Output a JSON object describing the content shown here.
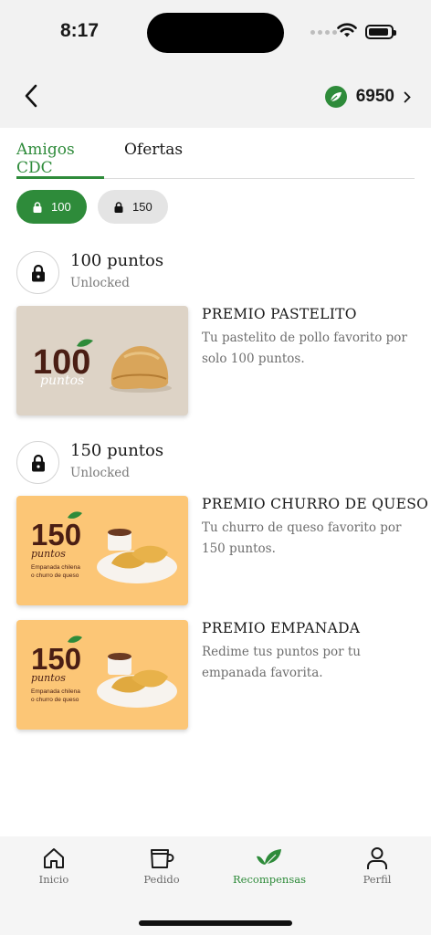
{
  "status": {
    "time": "8:17"
  },
  "header": {
    "points_value": "6950"
  },
  "tabs": [
    {
      "label": "Amigos CDC",
      "active": true
    },
    {
      "label": "Ofertas",
      "active": false
    }
  ],
  "filters": [
    {
      "label": "100",
      "active": true
    },
    {
      "label": "150",
      "active": false
    }
  ],
  "tiers": [
    {
      "title": "100 puntos",
      "status": "Unlocked",
      "rewards": [
        {
          "title": "PREMIO PASTELITO",
          "description": "Tu pastelito de pollo favorito por solo 100 puntos.",
          "image": {
            "big": "100",
            "script": "puntos"
          }
        }
      ]
    },
    {
      "title": "150 puntos",
      "status": "Unlocked",
      "rewards": [
        {
          "title": "PREMIO CHURRO DE QUESO",
          "description": "Tu churro de queso favorito por 150 puntos.",
          "image": {
            "big": "150",
            "script": "puntos",
            "caption1": "Empanada chilena",
            "caption2": "o churro de queso"
          }
        },
        {
          "title": "PREMIO EMPANADA",
          "description": "Redime tus puntos por tu empanada favorita.",
          "image": {
            "big": "150",
            "script": "puntos",
            "caption1": "Empanada chilena",
            "caption2": "o churro de queso"
          }
        }
      ]
    }
  ],
  "nav": [
    {
      "label": "Inicio",
      "icon": "home-icon"
    },
    {
      "label": "Pedido",
      "icon": "cup-icon"
    },
    {
      "label": "Recompensas",
      "icon": "leaf-icon",
      "active": true
    },
    {
      "label": "Perfil",
      "icon": "person-icon"
    }
  ],
  "colors": {
    "accent": "#2e8b3a",
    "card_beige": "#ddd3c6",
    "card_orange": "#fcc676",
    "brand_text": "#4a1e14"
  }
}
